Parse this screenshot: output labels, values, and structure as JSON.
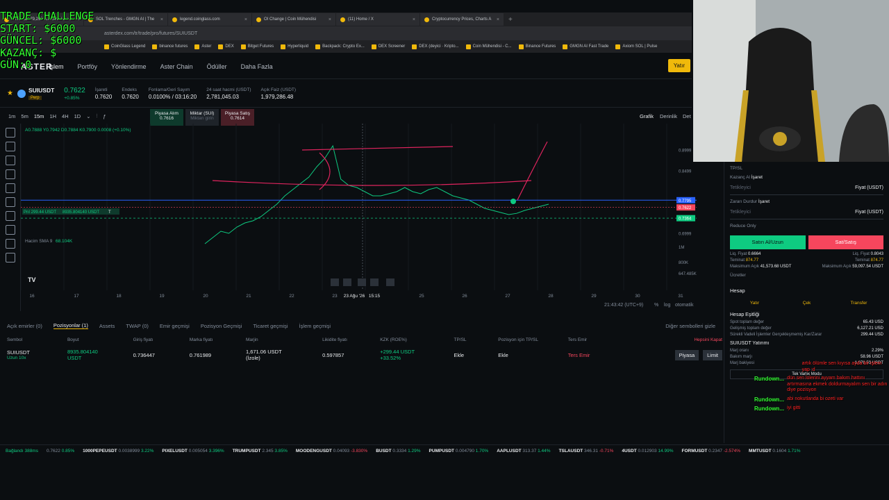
{
  "overlay": {
    "line1": "TRADE CHALLENGE",
    "line2": "START: $6000",
    "line3": "GÜNCEL: $6000",
    "line4": "KAZANÇ: $",
    "line5": "GÜN:0"
  },
  "browser": {
    "tabs": [
      "BTCUSD 79,293 ▲0.34% Uns...",
      "SOL Trenches - GMGN AI | The",
      "legend.coinglass.com",
      "OI Change | Coin Mühendisi",
      "(11) Home / X",
      "Cryptocurrency Prices, Charts A"
    ],
    "url": "asterdex.com/tr/trade/pro/futures/SUIUSDT",
    "bookmarks": [
      "CoinGlass Legend",
      "binance futures",
      "Aster",
      "DEX",
      "Bitget Futures",
      "Hyperliquid",
      "Backpack: Crypto Ex...",
      "DEX Screener",
      "DEX (deyici · Kripto...",
      "Coin Mühendisi - C...",
      "Binance Futures",
      "GMGN AI Fast Trade",
      "Axiom SOL | Pulse"
    ]
  },
  "nav": {
    "logo": "ASTER",
    "items": [
      "İşlem",
      "Portföy",
      "Yönlendirme",
      "Aster Chain",
      "Ödüller",
      "Daha Fazla"
    ],
    "deposit": "Yatır"
  },
  "ticker": {
    "symbol": "SUIUSDT",
    "badge": "Perp",
    "price": "0.7622",
    "change": "+0.85%",
    "mark_label": "İşareti",
    "mark": "0.7620",
    "index_label": "Endeks",
    "index": "0.7620",
    "funding_label": "Fonlama/Geri Sayım",
    "funding": "0.0100% / 03:16:20",
    "vol_label": "24 saat hacmi (USDT)",
    "vol": "2,781,045.03",
    "oi_label": "Açık Faiz (USDT)",
    "oi": "1,979,286.48"
  },
  "chart_tools": {
    "intervals": [
      "1m",
      "5m",
      "15m",
      "1H",
      "4H",
      "1D"
    ],
    "tabs": [
      "Grafik",
      "Derinlik",
      "Det"
    ],
    "ohlc": "A0.7888 Y0.7942 D0.7884 K0.7900 0.0008 (+0.10%)",
    "volume_label": "Hacim SMA 9",
    "volume_value": "68.104K",
    "position_label": "PnI 299.44 USDT",
    "position_size": "8935.804140 USDT",
    "position_tp": "T",
    "trade_buy_label": "Piyasa Alım",
    "trade_buy_price": "0.7616",
    "trade_mid_label": "Miktar (SUI)",
    "trade_mid_hint": "Miktarı girin",
    "trade_sell_label": "Piyasa Satış",
    "trade_sell_price": "0.7614"
  },
  "chart_data": {
    "type": "line",
    "x_ticks": [
      "16",
      "17",
      "18",
      "19",
      "20",
      "21",
      "22",
      "23",
      "23 Ağu '26",
      "15:15",
      "25",
      "26",
      "27",
      "28",
      "29",
      "30",
      "31"
    ],
    "y_ticks": [
      "0.8999",
      "0.8499",
      "0.7795",
      "0.7622",
      "0.7364",
      "0.6999"
    ],
    "y_labels_vol": [
      "1M",
      "800K",
      "647.485K"
    ],
    "ylim": [
      0.68,
      0.93
    ],
    "price_series": [
      0.675,
      0.69,
      0.705,
      0.7,
      0.715,
      0.725,
      0.73,
      0.74,
      0.755,
      0.77,
      0.79,
      0.805,
      0.82,
      0.835,
      0.86,
      0.88,
      0.91,
      0.83,
      0.815,
      0.81,
      0.8,
      0.79,
      0.79,
      0.795,
      0.8,
      0.81,
      0.8,
      0.795,
      0.805,
      0.81,
      0.8,
      0.79,
      0.785,
      0.78,
      0.77,
      0.76,
      0.755,
      0.75,
      0.745,
      0.748,
      0.755,
      0.76,
      0.765,
      0.77
    ],
    "current_price": 0.7622,
    "entry_price": 0.7364,
    "blue_line": 0.7795
  },
  "chart_foot": {
    "time": "21:43:42 (UTC+9)",
    "pct": "%",
    "log": "log",
    "auto": "otomatik"
  },
  "bottom_tabs": [
    "Açık emirler (0)",
    "Pozisyonlar (1)",
    "Assets",
    "TWAP (0)",
    "Emir geçmişi",
    "Pozisyon Geçmişi",
    "Ticaret geçmişi",
    "İşlem geçmişi"
  ],
  "hide_others": "Diğer sembolleri gizle",
  "positions": {
    "headers": [
      "Sembol",
      "Boyut",
      "Giriş fiyatı",
      "Marka fiyatı",
      "Marjin",
      "Likidite fiyatı",
      "KZK (ROE%)",
      "TP/SL",
      "Pozisyon için TP/SL",
      "Ters Emir",
      "Hepsini Kapat"
    ],
    "row": {
      "symbol": "SUIUSDT",
      "side": "Uzun 10x",
      "size": "8935.804140",
      "size_unit": "USDT",
      "entry": "0.736447",
      "mark": "0.761989",
      "margin": "1,671.06 USDT",
      "margin_type": "(İzole)",
      "liq": "0.597857",
      "pnl": "+299.44 USDT",
      "roe": "+33.52%",
      "tpsl": "Ekle",
      "pos_tpsl": "Ekle",
      "reverse": "Ters Emir",
      "market": "Piyasa",
      "limit": "Limit"
    }
  },
  "right_panel": {
    "tpsl_title": "TP/SL",
    "tp_label": "Kazanç Al",
    "tp_type": "İşaret",
    "tp_placeholder": "Tetikleyici",
    "tp_unit": "Fiyat (USDT)",
    "sl_label": "Zararı Durdur",
    "sl_type": "İşaret",
    "sl_placeholder": "Tetikleyici",
    "sl_unit": "Fiyat (USDT)",
    "reduce_only": "Reduce Only",
    "buy": "Satın Al/Uzun",
    "sell": "Sat/Satış",
    "liq_buy_l": "Liq. Fiyat",
    "liq_buy": "0.6664",
    "liq_sell_l": "Liq. Fiyat",
    "liq_sell": "0.8043",
    "cost_buy_l": "Teminat",
    "cost_buy": "874.77",
    "cost_sell_l": "Teminat",
    "cost_sell": "874.77",
    "max_buy_l": "Maksimum Açık",
    "max_buy": "41,573.68 USDT",
    "max_sell_l": "Maksimum Açık",
    "max_sell": "59,097.54 USDT",
    "fees": "Ücretler",
    "account_title": "Hesap",
    "acc_deposit": "Yatır",
    "acc_withdraw": "Çek",
    "acc_transfer": "Transfer",
    "equity_title": "Hesap Eşitliği",
    "spot_l": "Spot toplam değer",
    "spot": "65.43 USD",
    "futures_l": "Gelişmiş toplam değer",
    "futures": "6,127.21 USD",
    "unreal_l": "Sürekli Vadeli İşlemler Gerçekleşmemiş Kar/Zarar",
    "unreal": "299.44 USD",
    "margin_title": "SUIUSDT Yatırımı",
    "margin_ratio_l": "Marj oranı",
    "margin_ratio": "2.29%",
    "maint_l": "Bakım marjı",
    "maint": "58.96 USDT",
    "balance_l": "Marj bakiyesi",
    "balance": "1,970.50 USDT",
    "mode": "Tek Varlık Modu"
  },
  "chat": [
    {
      "name": "",
      "msg": "artık ölümle sen kıyısa ayda bir işlem yap :d"
    },
    {
      "name": "Rundown...",
      "msg": "dün sen lolerini ayyam bakım hattını artırmasına ekmek doldurmayalım sen bir adın diye pozisyon"
    },
    {
      "name": "Rundown...",
      "msg": "abi nokutlanda bi ozeti var"
    },
    {
      "name": "Rundown...",
      "msg": "iyi gitti"
    }
  ],
  "status": {
    "conn": "Bağlandı 388ms",
    "items": [
      {
        "sym": "",
        "price": "0.7622",
        "chg": "0.85%",
        "up": true
      },
      {
        "sym": "1000PEPEUSDT",
        "price": "0.0038999",
        "chg": "3.22%",
        "up": true
      },
      {
        "sym": "PIXELUSDT",
        "price": "0.005054",
        "chg": "3.396%",
        "up": true
      },
      {
        "sym": "TRUMPUSDT",
        "price": "2.345",
        "chg": "3.85%",
        "up": true
      },
      {
        "sym": "MOODENGUSDT",
        "price": "0.04093",
        "chg": "-3.830%",
        "up": false
      },
      {
        "sym": "BUSDT",
        "price": "0.3334",
        "chg": "1.29%",
        "up": true
      },
      {
        "sym": "PUMPUSDT",
        "price": "0.004790",
        "chg": "1.70%",
        "up": true
      },
      {
        "sym": "AAPLUSDT",
        "price": "313.37",
        "chg": "1.44%",
        "up": true
      },
      {
        "sym": "TSLAUSDT",
        "price": "346.31",
        "chg": "-0.71%",
        "up": false
      },
      {
        "sym": "4USDT",
        "price": "0.012903",
        "chg": "14.99%",
        "up": true
      },
      {
        "sym": "FORMUSDT",
        "price": "0.2347",
        "chg": "-2.574%",
        "up": false
      },
      {
        "sym": "MMTUSDT",
        "price": "0.1604",
        "chg": "1.71%",
        "up": true
      }
    ]
  },
  "colors": {
    "up": "#0ecb81",
    "down": "#f6465d",
    "accent": "#f0b90b",
    "annot": "#e0245e",
    "blue": "#2962ff"
  }
}
